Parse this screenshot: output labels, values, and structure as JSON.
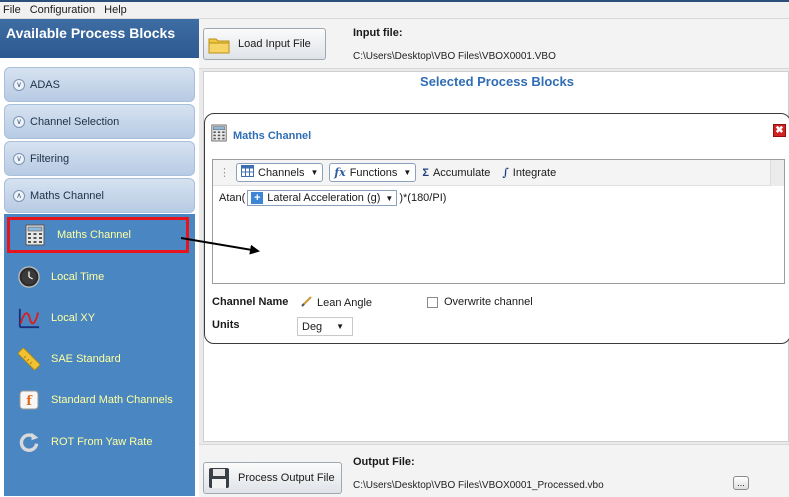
{
  "menu": {
    "items": [
      "File",
      "Configuration",
      "Help"
    ]
  },
  "sidebar": {
    "title": "Available Process Blocks",
    "categories": [
      {
        "label": "ADAS",
        "expanded": false
      },
      {
        "label": "Channel Selection",
        "expanded": false
      },
      {
        "label": "Filtering",
        "expanded": false
      },
      {
        "label": "Maths Channel",
        "expanded": true
      }
    ],
    "blocks": [
      {
        "label": "Maths Channel",
        "icon": "calculator-icon",
        "selected": true
      },
      {
        "label": "Local Time",
        "icon": "clock-icon"
      },
      {
        "label": "Local XY",
        "icon": "xy-graph-icon"
      },
      {
        "label": "SAE Standard",
        "icon": "ruler-icon"
      },
      {
        "label": "Standard Math Channels",
        "icon": "function-icon"
      },
      {
        "label": "ROT From Yaw Rate",
        "icon": "rotate-icon"
      }
    ]
  },
  "input": {
    "button_label": "Load Input File",
    "label": "Input file:",
    "path": "C:\\Users\\Desktop\\VBO Files\\VBOX0001.VBO"
  },
  "selected_blocks": {
    "title": "Selected Process Blocks",
    "card": {
      "title": "Maths Channel",
      "toolbar": {
        "channels": "Channels",
        "functions": "Functions",
        "accumulate": "Accumulate",
        "integrate": "Integrate"
      },
      "formula": {
        "prefix": "Atan(",
        "channel": "Lateral Acceleration (g)",
        "suffix": ")*(180/PI)"
      },
      "channel_name_label": "Channel Name",
      "channel_name_value": "Lean Angle",
      "overwrite_label": "Overwrite channel",
      "units_label": "Units",
      "units_value": "Deg"
    }
  },
  "output": {
    "button_label": "Process Output File",
    "label": "Output File:",
    "path": "C:\\Users\\Desktop\\VBO Files\\VBOX0001_Processed.vbo",
    "browse_label": "..."
  },
  "colors": {
    "sidebar_header": "#2d5a90",
    "blocks_bg": "#4a87c2",
    "block_text": "#ffffa0",
    "selection_border": "#e8141d",
    "accent_title": "#2f6db5"
  }
}
